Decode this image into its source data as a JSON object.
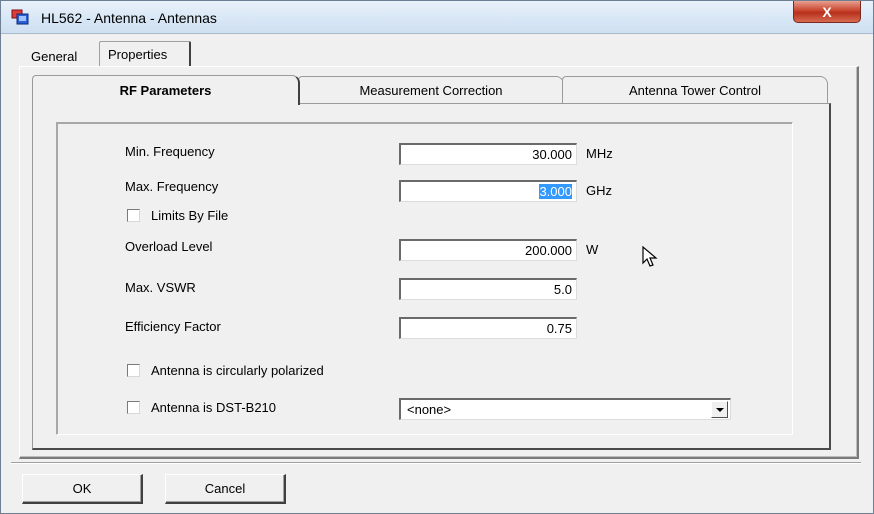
{
  "window": {
    "title": "HL562 - Antenna - Antennas",
    "close_label": "X"
  },
  "outer_tabs": [
    {
      "label": "General",
      "active": false
    },
    {
      "label": "Properties",
      "active": true
    }
  ],
  "inner_tabs": [
    {
      "label": "RF Parameters",
      "active": true
    },
    {
      "label": "Measurement Correction",
      "active": false
    },
    {
      "label": "Antenna Tower Control",
      "active": false
    }
  ],
  "fields": {
    "min_frequency": {
      "label": "Min. Frequency",
      "value": "30.000",
      "unit": "MHz"
    },
    "max_frequency": {
      "label": "Max. Frequency",
      "value": "3.000",
      "unit": "GHz"
    },
    "limits_by_file": {
      "label": "Limits By File",
      "checked": false
    },
    "overload_level": {
      "label": "Overload Level",
      "value": "200.000",
      "unit": "W"
    },
    "max_vswr": {
      "label": "Max. VSWR",
      "value": "5.0"
    },
    "efficiency_factor": {
      "label": "Efficiency Factor",
      "value": "0.75"
    },
    "circularly_polarized": {
      "label": "Antenna is circularly polarized",
      "checked": false
    },
    "dst_b210": {
      "label": "Antenna is DST-B210",
      "checked": false,
      "selected": "<none>"
    }
  },
  "buttons": {
    "ok": "OK",
    "cancel": "Cancel"
  }
}
